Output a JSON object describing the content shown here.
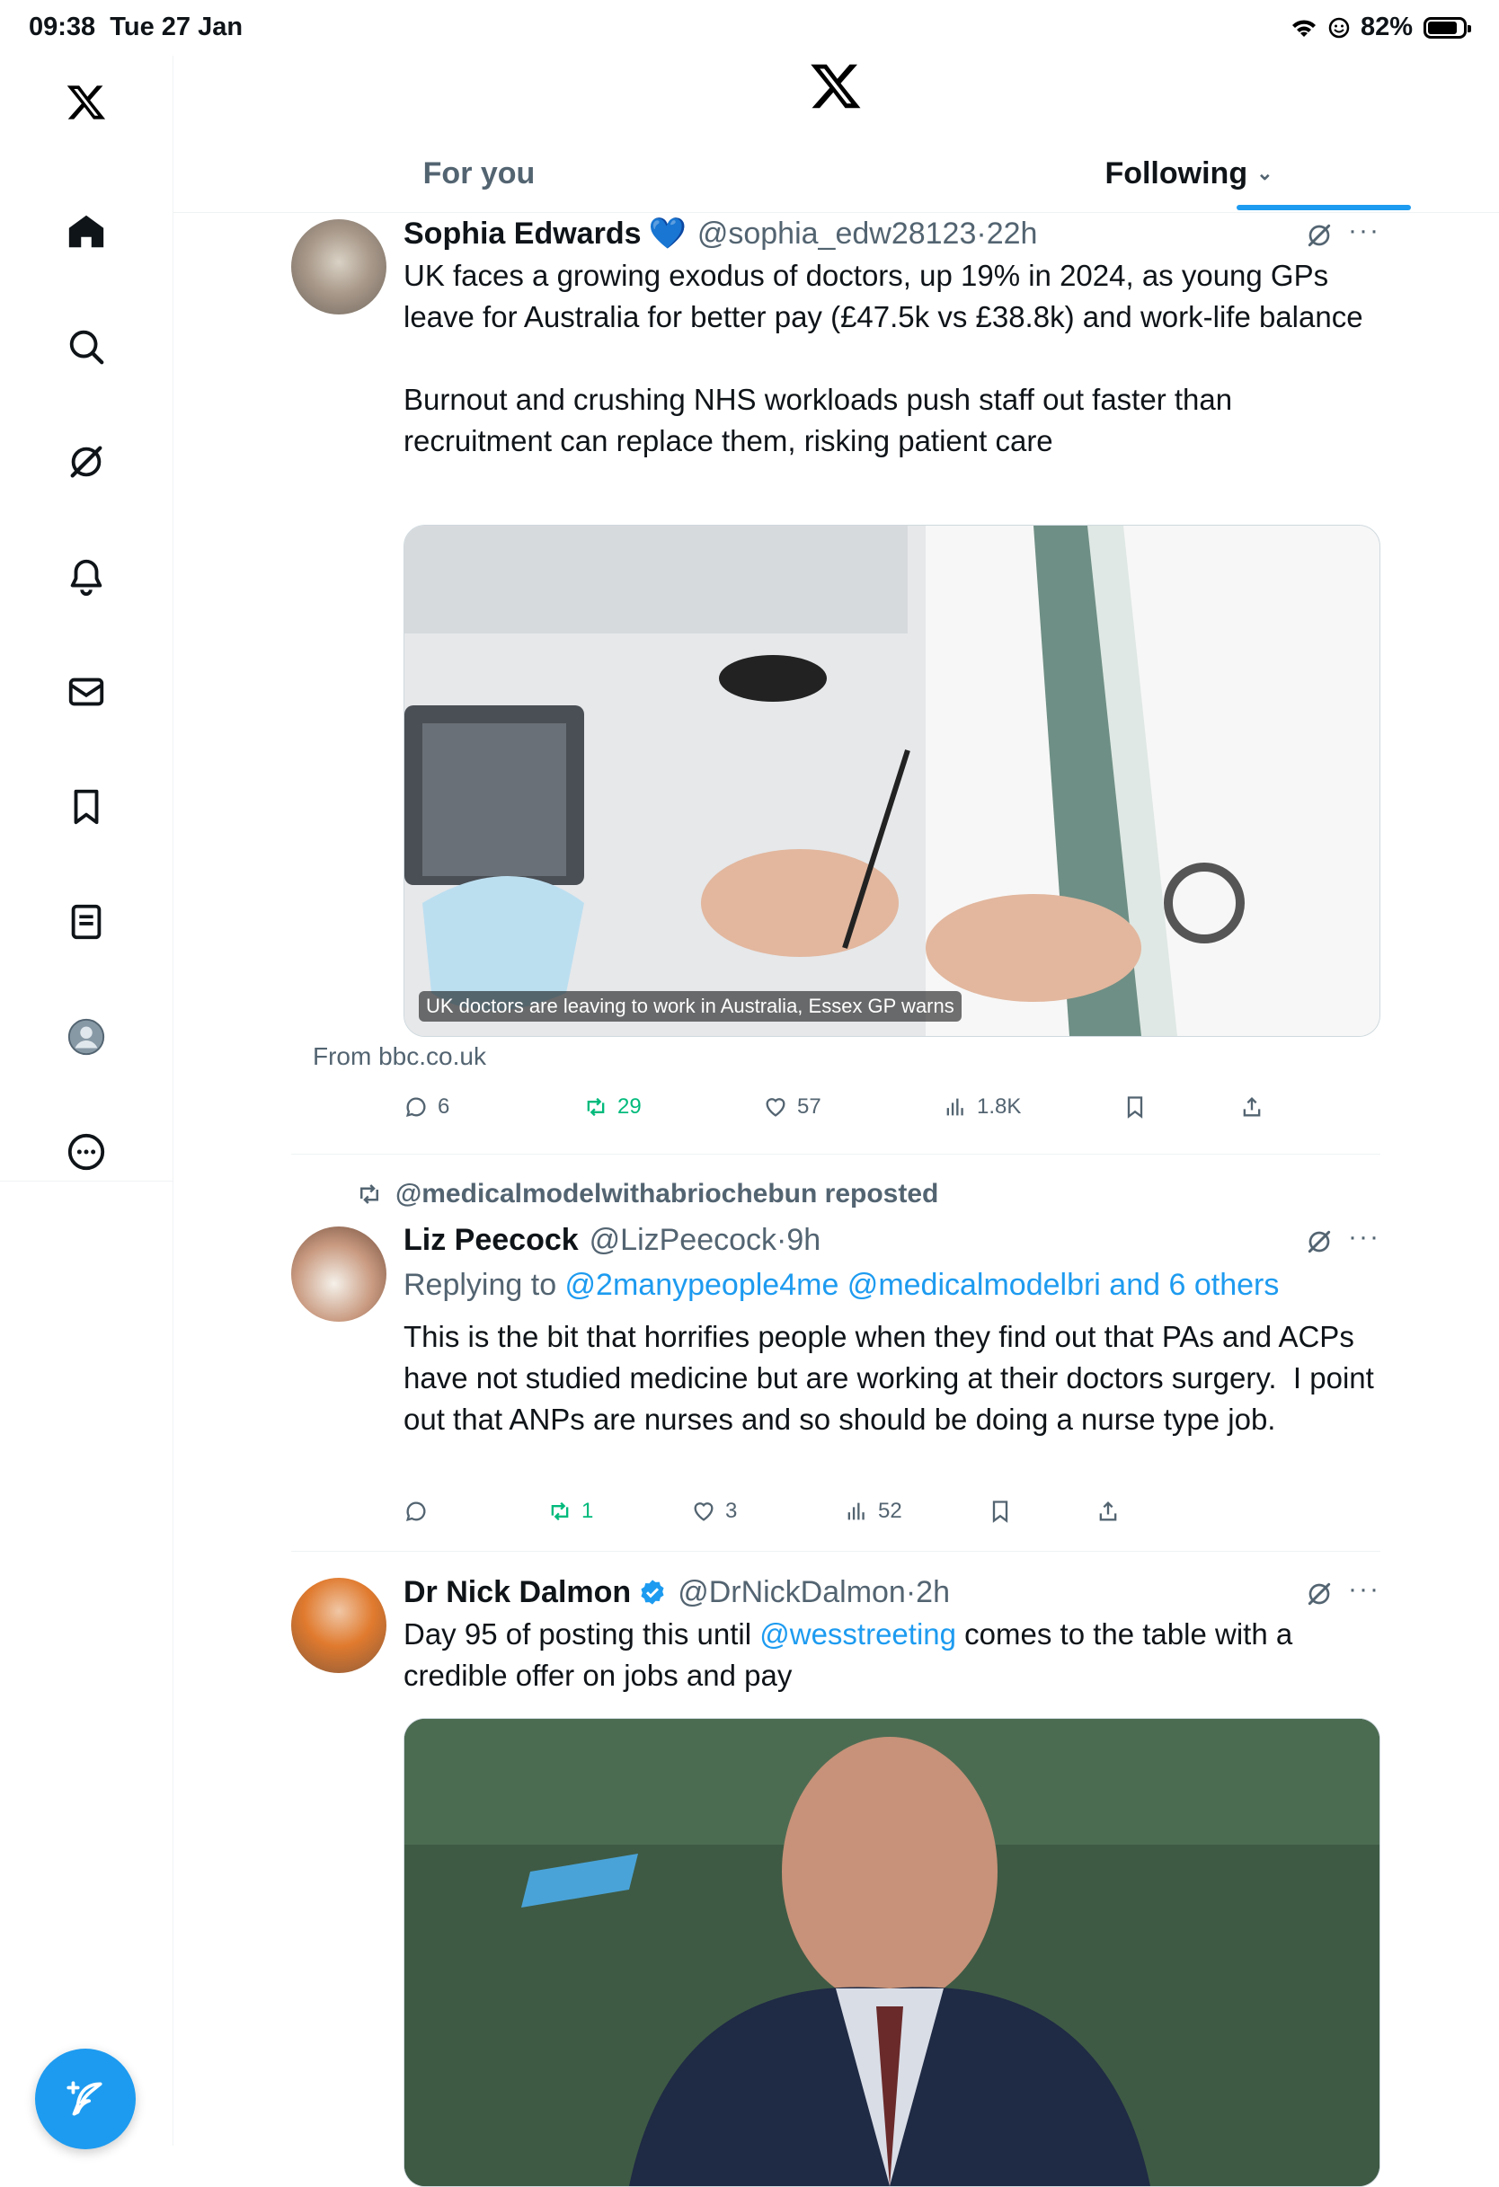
{
  "status": {
    "time": "09:38",
    "date": "Tue 27 Jan",
    "battery": "82%"
  },
  "nav": {
    "items": [
      {
        "icon": "x-logo-icon"
      },
      {
        "icon": "home-icon"
      },
      {
        "icon": "search-icon"
      },
      {
        "icon": "grok-icon"
      },
      {
        "icon": "bell-icon"
      },
      {
        "icon": "mail-icon"
      },
      {
        "icon": "bookmark-icon"
      },
      {
        "icon": "list-icon"
      },
      {
        "icon": "profile-icon"
      },
      {
        "icon": "more-icon"
      }
    ],
    "compose_icon": "compose-icon"
  },
  "tabs": {
    "for_you": "For you",
    "following": "Following"
  },
  "tweets": [
    {
      "name": "Sophia Edwards",
      "badge": "💙",
      "handle": "@sophia_edw28123",
      "time": "22h",
      "text": "UK faces a growing exodus of doctors, up 19% in 2024, as young GPs leave for Australia for better pay (£47.5k vs £38.8k) and work-life balance\n\nBurnout and crushing NHS workloads push staff out faster than recruitment can replace them, risking patient care",
      "card_caption": "UK doctors are leaving to work in Australia, Essex GP warns",
      "card_source": "From bbc.co.uk",
      "replies": "6",
      "reposts": "29",
      "likes": "57",
      "views": "1.8K"
    },
    {
      "reposted_by": "@medicalmodelwithabriochebun reposted",
      "name": "Liz Peecock",
      "handle": "@LizPeecock",
      "time": "9h",
      "replying_prefix": "Replying to ",
      "replying_to": "@2manypeople4me @medicalmodelbri and 6 others",
      "text": "This is the bit that horrifies people when they find out that PAs and ACPs have not studied medicine but are working at their doctors surgery.  I point out that ANPs are nurses and so should be doing a nurse type job.",
      "replies": "",
      "reposts": "1",
      "likes": "3",
      "views": "52"
    },
    {
      "name": "Dr Nick Dalmon",
      "handle": "@DrNickDalmon",
      "time": "2h",
      "text_prefix": "Day 95 of posting this until ",
      "mention": "@wesstreeting",
      "text_suffix": " comes to the table with a credible offer on jobs and pay"
    }
  ],
  "colors": {
    "accent": "#1d9bf0",
    "repost_green": "#00ba7c",
    "secondary": "#536471"
  }
}
